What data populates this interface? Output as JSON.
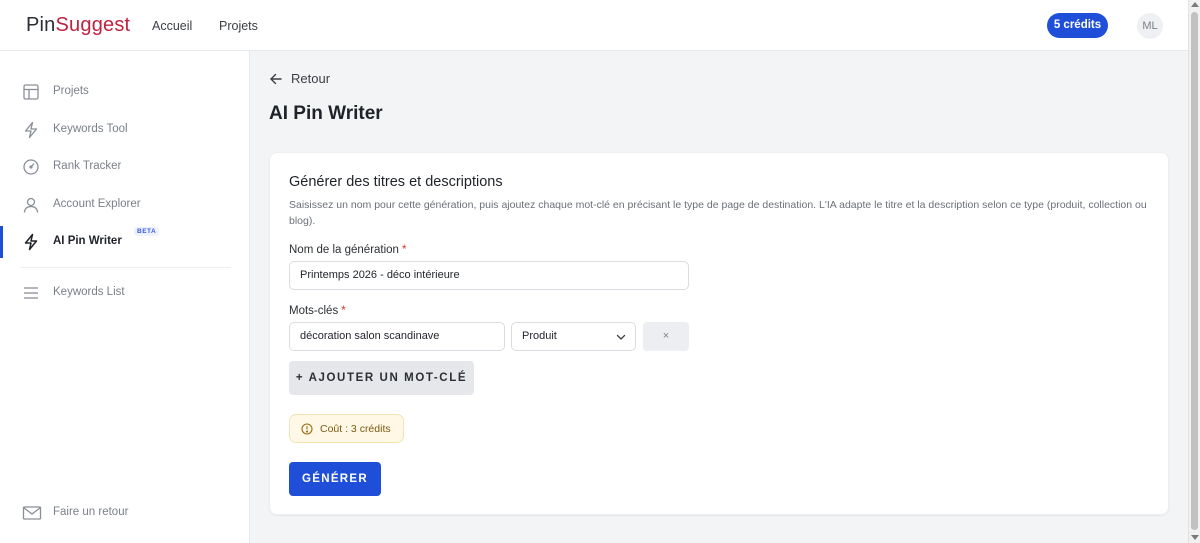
{
  "header": {
    "logo_part1": "Pin",
    "logo_part2": "Suggest",
    "nav": [
      "Accueil",
      "Projets"
    ],
    "credits": "5 crédits",
    "avatar": "ML"
  },
  "sidebar": {
    "items": [
      {
        "label": "Projets",
        "icon": "layout-icon"
      },
      {
        "label": "Keywords Tool",
        "icon": "lightning-icon"
      },
      {
        "label": "Rank Tracker",
        "icon": "gauge-icon"
      },
      {
        "label": "Account Explorer",
        "icon": "user-icon"
      },
      {
        "label": "AI Pin Writer",
        "icon": "lightning-icon",
        "active": true,
        "badge": "BETA"
      },
      {
        "label": "Keywords List",
        "icon": "menu-icon"
      }
    ],
    "feedback": "Faire un retour"
  },
  "main": {
    "back": "Retour",
    "title": "AI Pin Writer",
    "card": {
      "title": "Générer des titres et descriptions",
      "description": "Saisissez un nom pour cette génération, puis ajoutez chaque mot-clé en précisant le type de page de destination. L'IA adapte le titre et la description selon ce type (produit, collection ou blog).",
      "name_label": "Nom de la génération",
      "name_value": "Printemps 2026 - déco intérieure",
      "keywords_label": "Mots-clés",
      "required_mark": "*",
      "keyword_value": "décoration salon scandinave",
      "type_value": "Produit",
      "remove_label": "×",
      "add_label": "+ AJOUTER UN MOT-CLÉ",
      "cost": "Coût : 3 crédits",
      "generate_label": "GÉNÉRER"
    }
  },
  "colors": {
    "accent": "#1f4fd9",
    "brand": "#c0223e",
    "cost_bg": "#fff8e6"
  }
}
